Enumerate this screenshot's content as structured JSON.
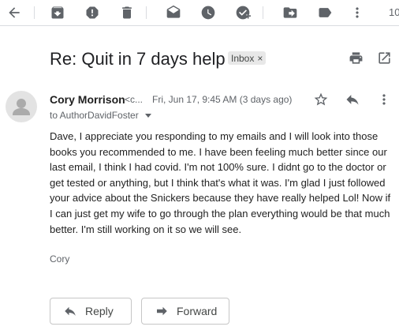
{
  "toolbar": {
    "icons": [
      "back-arrow-icon",
      "archive-icon",
      "report-spam-icon",
      "trash-icon",
      "mark-unread-icon",
      "snooze-icon",
      "add-task-icon",
      "move-to-icon",
      "labels-icon",
      "more-vert-icon"
    ],
    "count_text": "10"
  },
  "message": {
    "subject": "Re: Quit in 7 days help",
    "label": "Inbox",
    "label_remove": "×",
    "sender_name": "Cory Morrison",
    "sender_email": "<c...",
    "date": "Fri, Jun 17, 9:45 AM (3 days ago)",
    "to": "to AuthorDavidFoster",
    "body": "Dave, I appreciate you responding to my emails and I will look into those books you recommended to me.  I have been feeling much better since our last email, I think I had covid.  I'm not 100% sure.  I didnt go to the doctor or get tested or anything, but I think that's what it was.  I'm glad I just followed your advice about the Snickers because they have really helped Lol!  Now if I can just get my wife to go through the plan everything would be that much better.  I'm still working on it so we will see.",
    "signature": "Cory"
  },
  "actions": {
    "reply_label": "Reply",
    "forward_label": "Forward"
  }
}
